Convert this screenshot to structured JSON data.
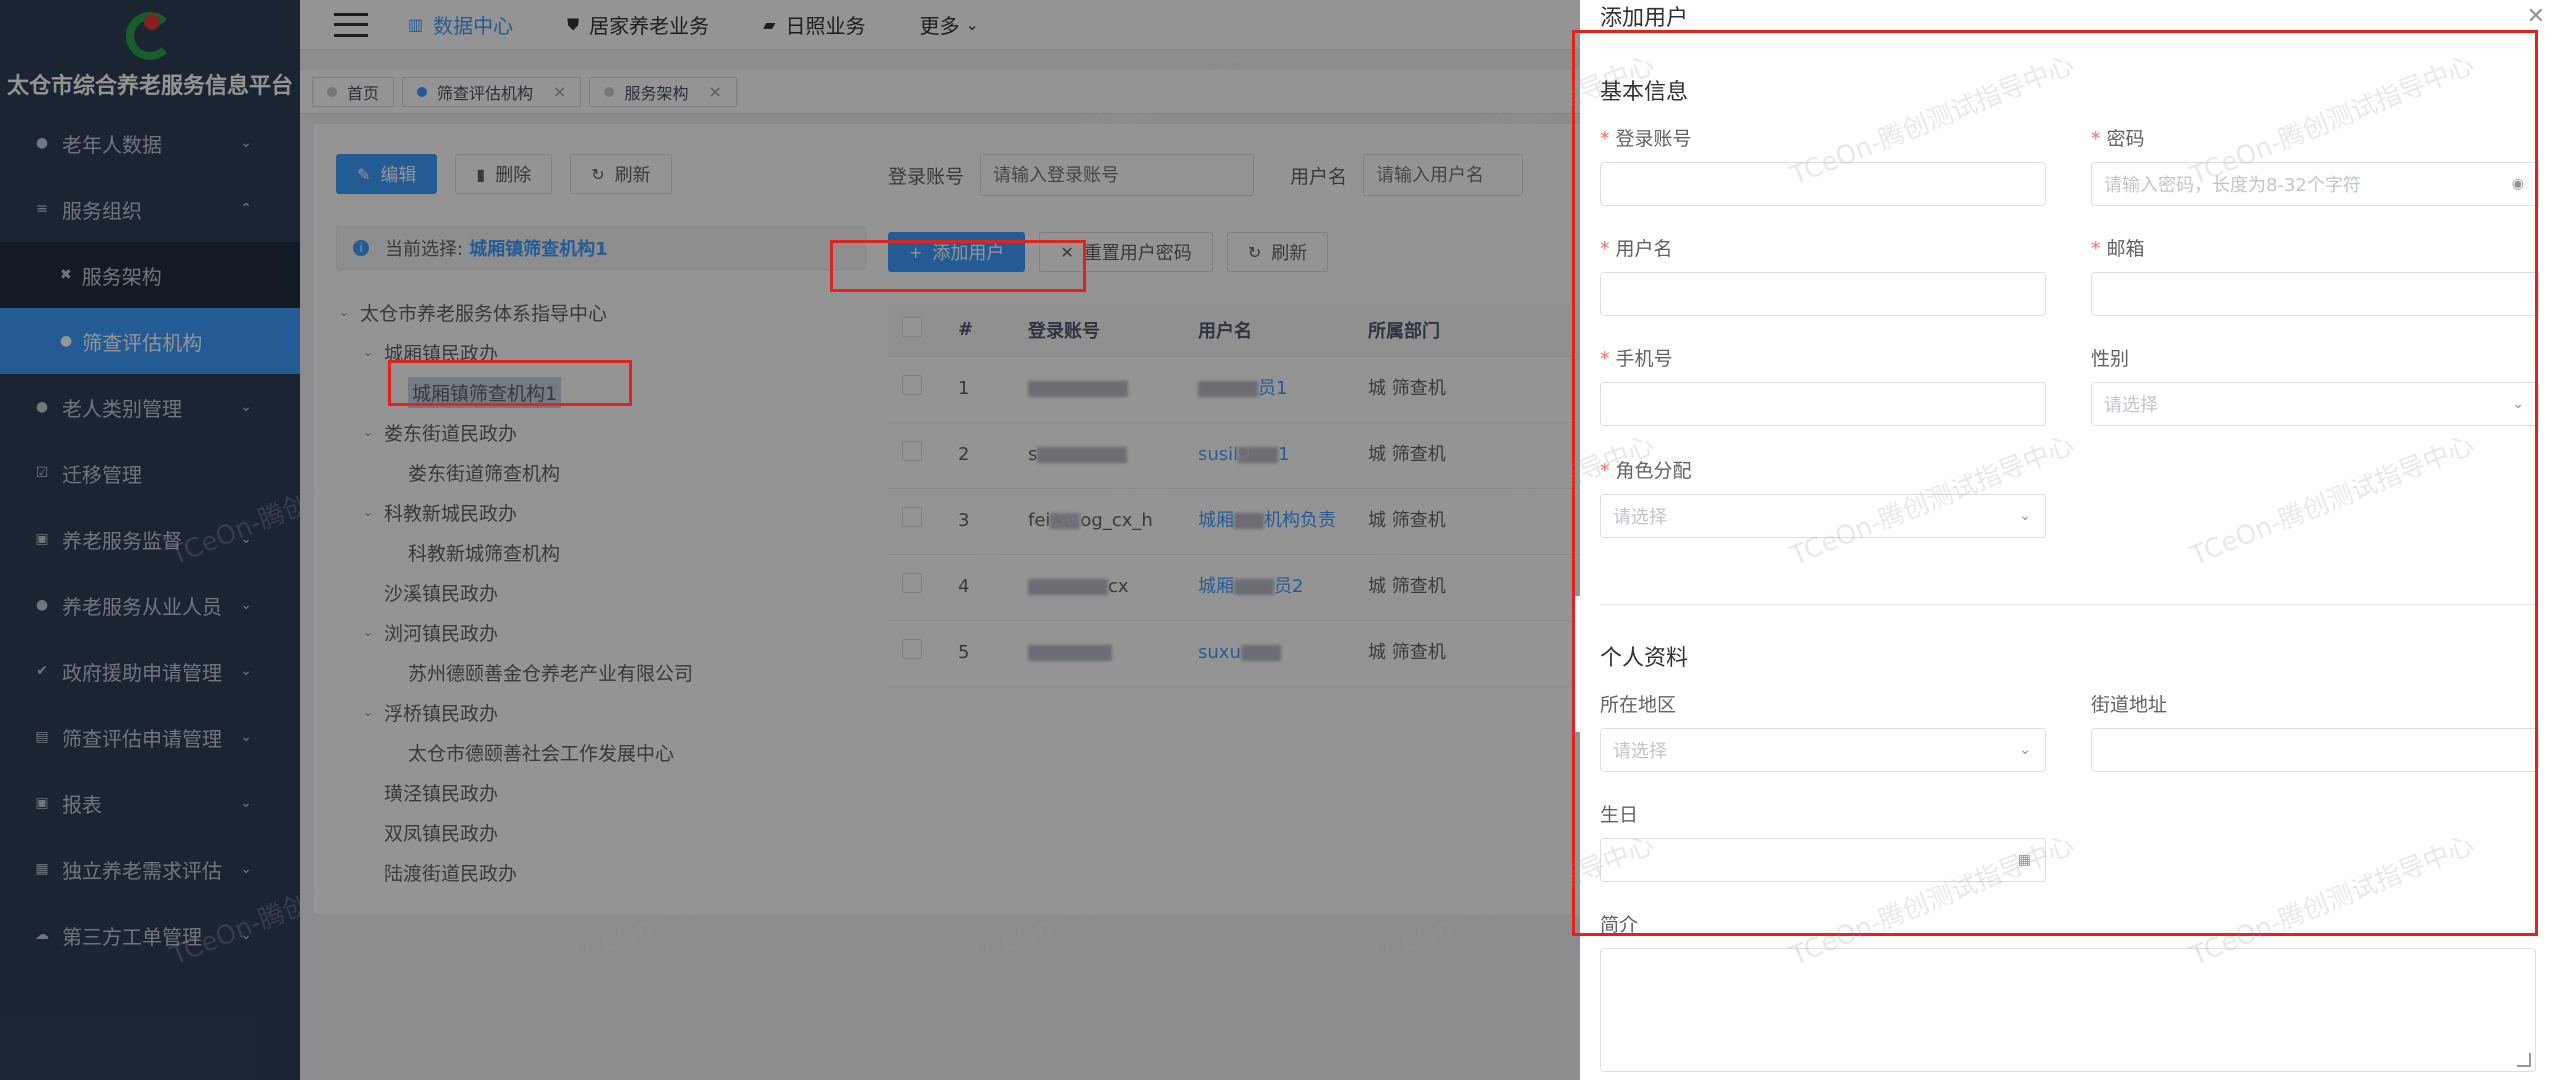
{
  "app": {
    "title": "太仓市综合养老服务信息平台"
  },
  "sidebar": {
    "items": [
      {
        "label": "老年人数据",
        "icon": "users-icon",
        "chevron": "⌄"
      },
      {
        "label": "服务组织",
        "icon": "menu-icon",
        "chevron": "⌃"
      },
      {
        "label": "服务架构",
        "icon": "tools-icon",
        "sub": true
      },
      {
        "label": "筛查评估机构",
        "icon": "dot-icon",
        "sub": true,
        "active": true
      },
      {
        "label": "老人类别管理",
        "icon": "users-icon",
        "chevron": "⌄"
      },
      {
        "label": "迁移管理",
        "icon": "check-square-icon"
      },
      {
        "label": "养老服务监督",
        "icon": "clipboard-icon",
        "chevron": "⌄"
      },
      {
        "label": "养老服务从业人员",
        "icon": "people-icon",
        "chevron": "⌄"
      },
      {
        "label": "政府援助申请管理",
        "icon": "check-circle-icon",
        "chevron": "⌄"
      },
      {
        "label": "筛查评估申请管理",
        "icon": "list-icon",
        "chevron": "⌄"
      },
      {
        "label": "报表",
        "icon": "clipboard-icon",
        "chevron": "⌄"
      },
      {
        "label": "独立养老需求评估",
        "icon": "form-icon",
        "chevron": "⌄"
      },
      {
        "label": "第三方工单管理",
        "icon": "cloud-icon",
        "chevron": "⌄"
      }
    ]
  },
  "topnav": {
    "items": [
      {
        "label": "数据中心",
        "icon": "chart-icon",
        "active": true
      },
      {
        "label": "居家养老业务",
        "icon": "shield-icon"
      },
      {
        "label": "日照业务",
        "icon": "briefcase-icon"
      },
      {
        "label": "更多",
        "icon": "chevron-down-icon",
        "suffix": "⌄"
      }
    ]
  },
  "tags": [
    {
      "label": "首页",
      "closable": false,
      "active": false
    },
    {
      "label": "筛查评估机构",
      "closable": true,
      "active": true
    },
    {
      "label": "服务架构",
      "closable": true,
      "active": false
    }
  ],
  "toolbar": {
    "edit": "编辑",
    "delete": "删除",
    "refresh": "刷新",
    "add_user": "添加用户",
    "reset_password": "重置用户密码",
    "refresh2": "刷新"
  },
  "current_selection": {
    "prefix": "当前选择:",
    "value": "城厢镇筛查机构1"
  },
  "tree": {
    "nodes": [
      {
        "label": "太仓市养老服务体系指导中心",
        "level": 0,
        "expanded": true
      },
      {
        "label": "城厢镇民政办",
        "level": 1,
        "expanded": true
      },
      {
        "label": "城厢镇筛查机构1",
        "level": 2,
        "selected": true
      },
      {
        "label": "娄东街道民政办",
        "level": 1,
        "expanded": true
      },
      {
        "label": "娄东街道筛查机构",
        "level": 2
      },
      {
        "label": "科教新城民政办",
        "level": 1,
        "expanded": true
      },
      {
        "label": "科教新城筛查机构",
        "level": 2
      },
      {
        "label": "沙溪镇民政办",
        "level": 1
      },
      {
        "label": "浏河镇民政办",
        "level": 1,
        "expanded": true
      },
      {
        "label": "苏州德颐善金仓养老产业有限公司",
        "level": 2
      },
      {
        "label": "浮桥镇民政办",
        "level": 1,
        "expanded": true
      },
      {
        "label": "太仓市德颐善社会工作发展中心",
        "level": 2
      },
      {
        "label": "璜泾镇民政办",
        "level": 1
      },
      {
        "label": "双凤镇民政办",
        "level": 1
      },
      {
        "label": "陆渡街道民政办",
        "level": 1
      }
    ]
  },
  "search": {
    "login_label": "登录账号",
    "login_placeholder": "请输入登录账号",
    "username_label": "用户名",
    "username_placeholder": "请输入用户名"
  },
  "table": {
    "columns": [
      "#",
      "登录账号",
      "用户名",
      "所属部门"
    ],
    "rows": [
      {
        "no": "1",
        "login_tail": "",
        "name_tail": "员1",
        "dept": "城 筛查机"
      },
      {
        "no": "2",
        "login_head": "s",
        "name_head": "susil",
        "name_tail": "1",
        "dept": "城 筛查机"
      },
      {
        "no": "3",
        "login_head": "fei",
        "login_tail": "og_cx_h",
        "name_head": "城厢",
        "name_tail": "机构负责",
        "dept": "城 筛查机"
      },
      {
        "no": "4",
        "login_tail": "cx",
        "name_head": "城厢",
        "name_tail": "员2",
        "dept": "城 筛查机"
      },
      {
        "no": "5",
        "name_head": "suxu",
        "dept": "城 筛查机"
      }
    ]
  },
  "drawer": {
    "title": "添加用户",
    "basic_section": "基本信息",
    "personal_section": "个人资料",
    "fields": {
      "login": {
        "label": "登录账号",
        "required": true,
        "placeholder": ""
      },
      "password": {
        "label": "密码",
        "required": true,
        "placeholder": "请输入密码，长度为8-32个字符"
      },
      "username": {
        "label": "用户名",
        "required": true,
        "placeholder": ""
      },
      "email": {
        "label": "邮箱",
        "required": true,
        "placeholder": ""
      },
      "phone": {
        "label": "手机号",
        "required": true,
        "placeholder": ""
      },
      "gender": {
        "label": "性别",
        "required": false,
        "placeholder": "请选择"
      },
      "role": {
        "label": "角色分配",
        "required": true,
        "placeholder": "请选择"
      },
      "region": {
        "label": "所在地区",
        "placeholder": "请选择"
      },
      "street": {
        "label": "街道地址",
        "placeholder": ""
      },
      "birthday": {
        "label": "生日",
        "placeholder": ""
      },
      "bio": {
        "label": "简介",
        "placeholder": ""
      }
    }
  },
  "watermark": "TCeOn-腾创测试指导中心",
  "colors": {
    "sidebar_bg": "#304156",
    "primary": "#409eff",
    "annotation": "#e0241b",
    "required": "#f56c6c"
  }
}
